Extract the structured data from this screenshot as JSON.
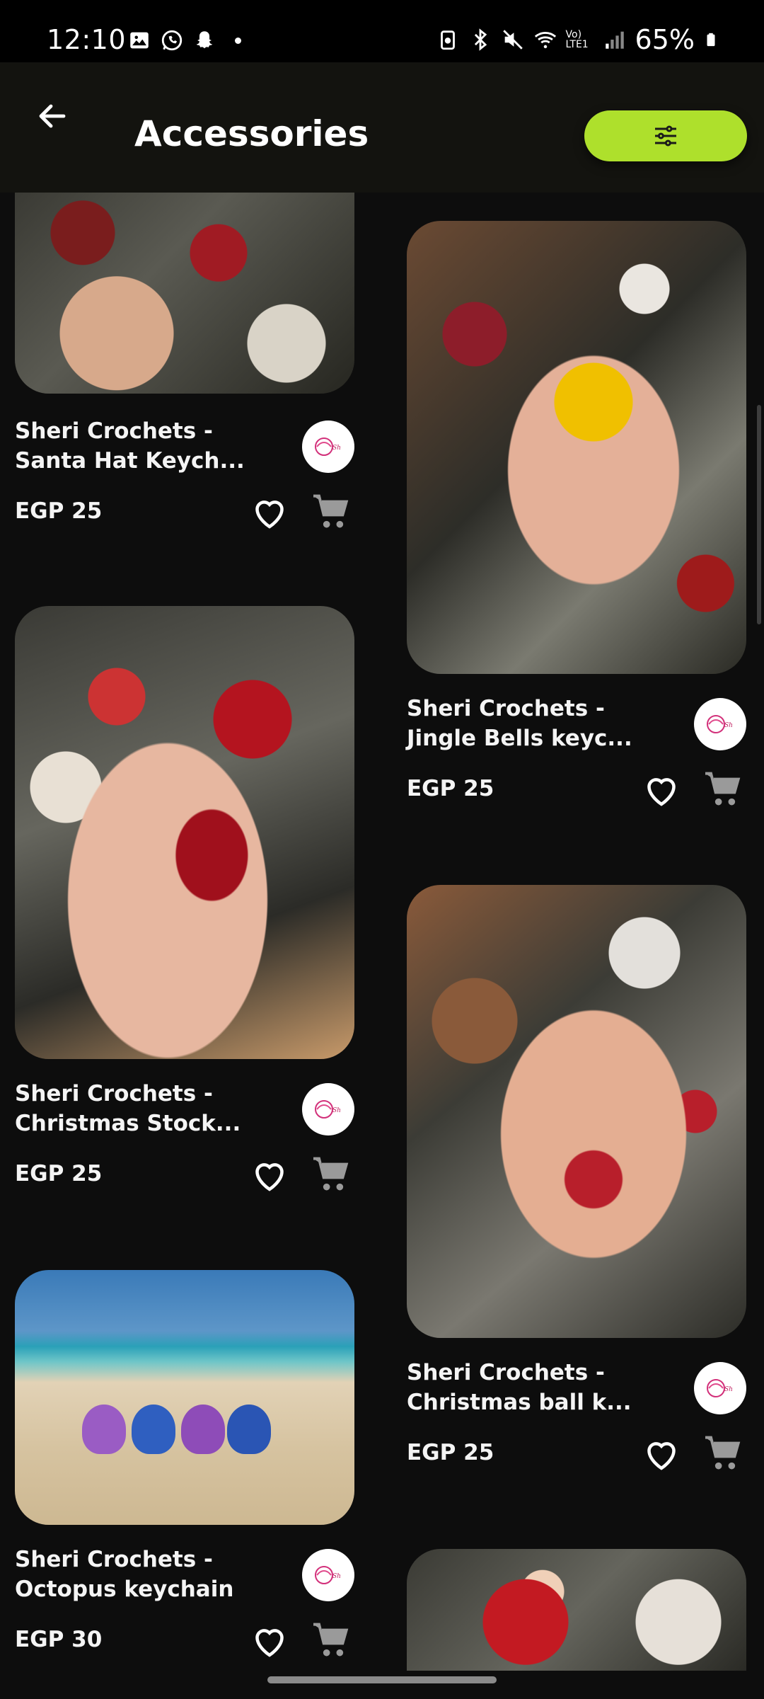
{
  "status_bar": {
    "time": "12:10",
    "battery": "65%",
    "network": "Vo) LTE1"
  },
  "header": {
    "title": "Accessories",
    "accent_color": "#aee02c"
  },
  "products": [
    {
      "title": "Sheri Crochets - Santa Hat Keych...",
      "price": "EGP 25"
    },
    {
      "title": "Sheri Crochets - Jingle Bells keyc...",
      "price": "EGP 25"
    },
    {
      "title": "Sheri Crochets - Christmas Stock...",
      "price": "EGP 25"
    },
    {
      "title": "Sheri Crochets - Christmas ball k...",
      "price": "EGP 25"
    },
    {
      "title": "Sheri Crochets - Octopus keychain",
      "price": "EGP 30"
    }
  ]
}
